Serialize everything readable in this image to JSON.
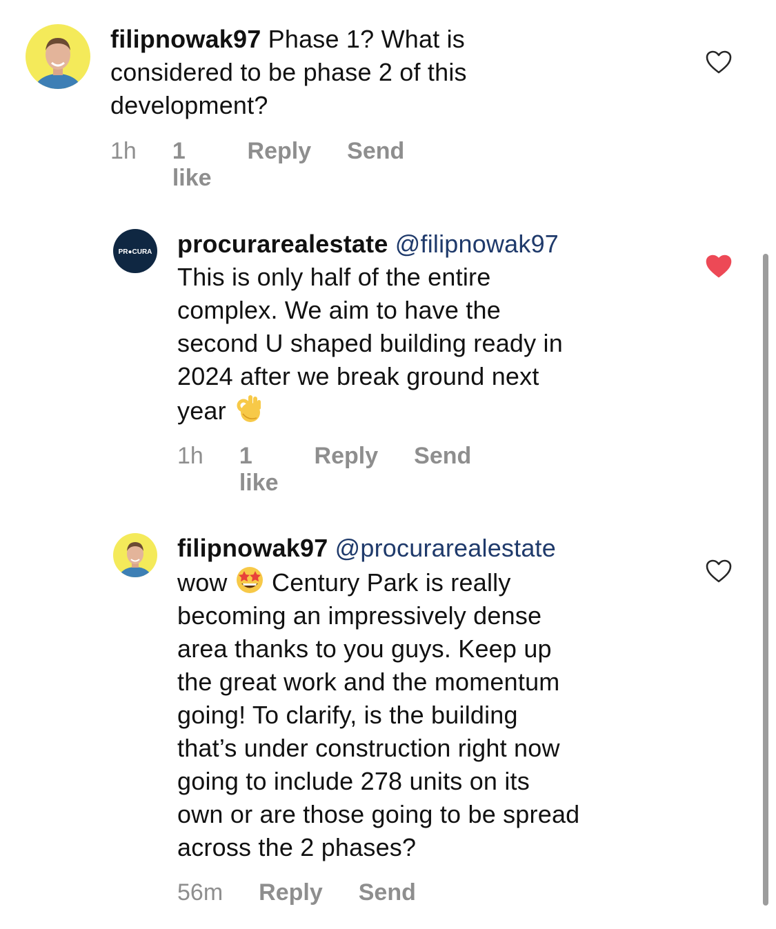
{
  "comments": [
    {
      "username": "filipnowak97",
      "text_line1": " Phase 1? What is",
      "text_line2": "considered to be phase 2 of this",
      "text_line3": "development?",
      "time": "1h",
      "likes": "1 like",
      "reply_label": "Reply",
      "send_label": "Send",
      "liked": false
    },
    {
      "username": "procurarealestate",
      "mention": "@filipnowak97",
      "text_line1": "This is only half of the entire",
      "text_line2": "complex. We aim to have the",
      "text_line3": "second U shaped building ready in",
      "text_line4": "2024 after we break ground next",
      "text_line5": "year",
      "emoji": "ok-hand",
      "avatar_logo": "PR●CURA",
      "time": "1h",
      "likes": "1 like",
      "reply_label": "Reply",
      "send_label": "Send",
      "liked": true
    },
    {
      "username": "filipnowak97",
      "mention": "@procurarealestate",
      "text_line1a": "wow ",
      "emoji": "star-struck",
      "text_line1b": " Century Park is really",
      "text_line2": "becoming an impressively dense",
      "text_line3": "area thanks to you guys. Keep up",
      "text_line4": "the great work and the momentum",
      "text_line5": "going! To clarify, is the building",
      "text_line6": "that’s under construction right now",
      "text_line7": "going to include 278 units on its",
      "text_line8": "own or are those going to be spread",
      "text_line9": "across the 2 phases?",
      "time": "56m",
      "reply_label": "Reply",
      "send_label": "Send",
      "liked": false
    }
  ],
  "colors": {
    "meta_gray": "#8e8e8e",
    "mention_blue": "#1f3a6b",
    "like_red": "#ed4956",
    "avatar_bg_yellow": "#f4ea5a",
    "avatar_bg_navy": "#0f2742"
  }
}
